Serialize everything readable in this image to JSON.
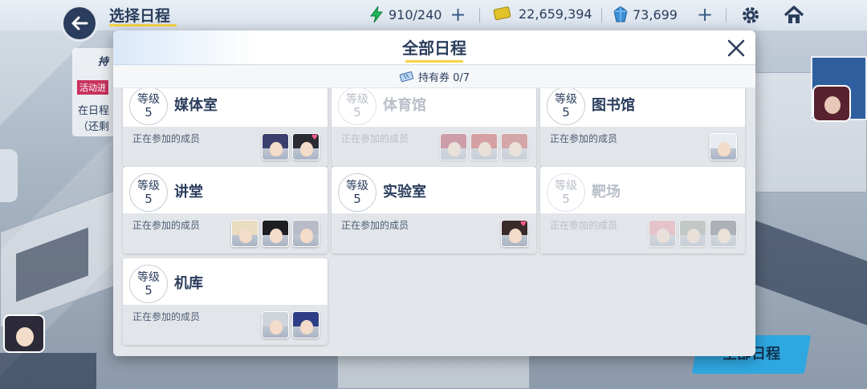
{
  "header": {
    "title": "选择日程",
    "resources": [
      {
        "name": "stamina",
        "value": "910/240",
        "icon": "lightning-icon",
        "color": "#1fb55a",
        "has_plus": true
      },
      {
        "name": "credits",
        "value": "22,659,394",
        "icon": "credit-card-icon",
        "color": "#e0c22a",
        "has_plus": false
      },
      {
        "name": "gems",
        "value": "73,699",
        "icon": "crystal-icon",
        "color": "#3b8fd6",
        "has_plus": true
      }
    ]
  },
  "side": {
    "tab_label": "持",
    "event_tag": "活动进",
    "line1": "在日程",
    "line2": "（还剩"
  },
  "bottom_button": "全部日程",
  "modal": {
    "title": "全部日程",
    "ticket_label": "持有券 0/7",
    "members_label": "正在参加的成员",
    "level_label": "等级",
    "cards": [
      {
        "name": "媒体室",
        "level": "5",
        "locked": false,
        "members": [
          "#3b3f6e",
          "#2b2b33"
        ]
      },
      {
        "name": "体育馆",
        "level": "5",
        "locked": true,
        "members": [
          "#b8475e",
          "#c84b4b",
          "#c25a5a"
        ]
      },
      {
        "name": "图书馆",
        "level": "5",
        "locked": false,
        "members": [
          "#e8ecf2"
        ]
      },
      {
        "name": "讲堂",
        "level": "5",
        "locked": false,
        "members": [
          "#e9dcc0",
          "#1d1d24",
          "#b9bcc8"
        ]
      },
      {
        "name": "实验室",
        "level": "5",
        "locked": false,
        "members": [
          "#3a2a2a"
        ]
      },
      {
        "name": "靶场",
        "level": "5",
        "locked": true,
        "members": [
          "#e89aa8",
          "#9aa59a",
          "#6b6f7a"
        ]
      },
      {
        "name": "机库",
        "level": "5",
        "locked": false,
        "members": [
          "#cfd3da",
          "#2d3e86"
        ]
      }
    ]
  }
}
